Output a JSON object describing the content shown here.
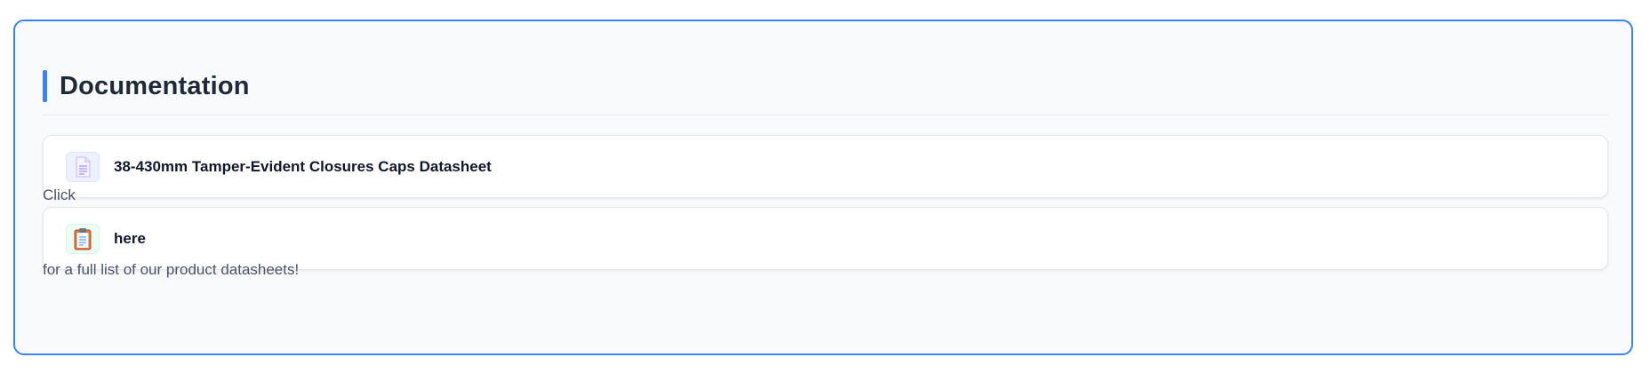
{
  "section": {
    "title": "Documentation"
  },
  "documents": [
    {
      "label": "38-430mm Tamper-Evident Closures Caps Datasheet",
      "icon": "document-icon"
    }
  ],
  "footer_note": {
    "prefix": "Click",
    "link": {
      "label": "here",
      "icon": "clipboard-icon"
    },
    "suffix": "for a full list of our product datasheets!"
  },
  "colors": {
    "accent": "#3b82f6",
    "panel_background": "#f8fafc",
    "card_background": "#ffffff",
    "heading_text": "#1f2937",
    "body_text": "#4b5563"
  }
}
